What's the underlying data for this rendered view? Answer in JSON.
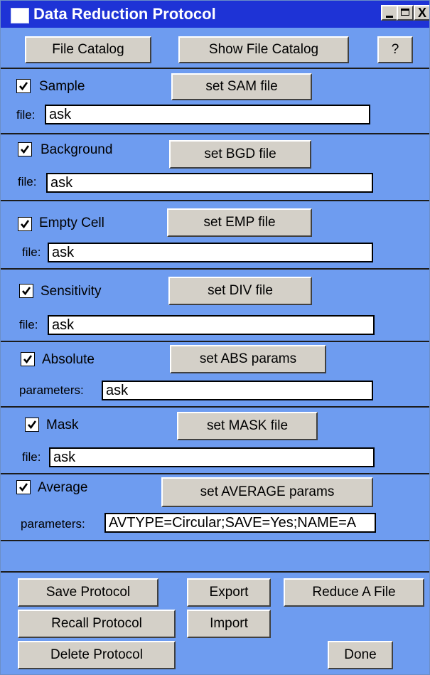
{
  "window": {
    "title": "Data Reduction Protocol",
    "controls": {
      "minimize": "_",
      "maximize": "□",
      "close": "X"
    }
  },
  "toolbar": {
    "file_catalog": "File Catalog",
    "show_file_catalog": "Show File Catalog",
    "help": "?"
  },
  "sections": {
    "sample": {
      "checked": true,
      "label": "Sample",
      "button": "set SAM file",
      "field_label": "file:",
      "value": "ask"
    },
    "background": {
      "checked": true,
      "label": "Background",
      "button": "set BGD file",
      "field_label": "file:",
      "value": "ask"
    },
    "empty_cell": {
      "checked": true,
      "label": "Empty Cell",
      "button": "set EMP file",
      "field_label": "file:",
      "value": "ask"
    },
    "sensitivity": {
      "checked": true,
      "label": "Sensitivity",
      "button": "set DIV file",
      "field_label": "file:",
      "value": "ask"
    },
    "absolute": {
      "checked": true,
      "label": "Absolute",
      "button": "set ABS params",
      "field_label": "parameters:",
      "value": "ask"
    },
    "mask": {
      "checked": true,
      "label": "Mask",
      "button": "set MASK file",
      "field_label": "file:",
      "value": "ask"
    },
    "average": {
      "checked": true,
      "label": "Average",
      "button": "set AVERAGE params",
      "field_label": "parameters:",
      "value": "AVTYPE=Circular;SAVE=Yes;NAME=A"
    }
  },
  "actions": {
    "save_protocol": "Save Protocol",
    "export": "Export",
    "reduce_a_file": "Reduce A File",
    "recall_protocol": "Recall Protocol",
    "import": "Import",
    "delete_protocol": "Delete Protocol",
    "done": "Done"
  },
  "colors": {
    "title_bar": "#1e33d6",
    "panel_background": "#6e9cf0",
    "button_face": "#d4d0c8"
  }
}
